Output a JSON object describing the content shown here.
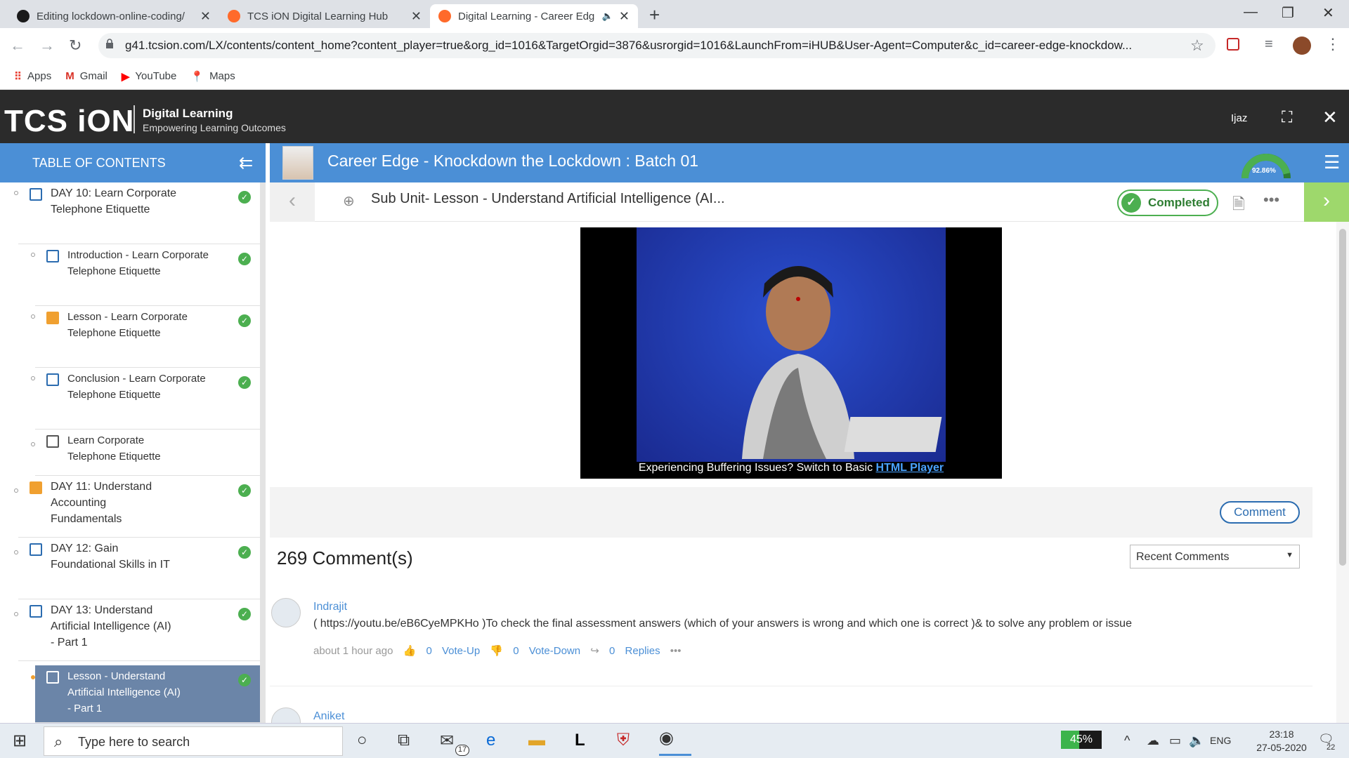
{
  "browser": {
    "tabs": [
      {
        "title": "Editing lockdown-online-coding/",
        "favicon_color": "#1a1a1a"
      },
      {
        "title": "TCS iON Digital Learning Hub",
        "favicon_color": "#ff6a2a"
      },
      {
        "title": "Digital Learning - Career Edg",
        "favicon_color": "#ff6a2a",
        "active": true
      }
    ],
    "url": "g41.tcsion.com/LX/contents/content_home?content_player=true&org_id=1016&TargetOrgid=3876&usrorgid=1016&LaunchFrom=iHUB&User-Agent=Computer&c_id=career-edge-knockdow...",
    "bookmarks": [
      "Apps",
      "Gmail",
      "YouTube",
      "Maps"
    ]
  },
  "header": {
    "logo": "TCS iON",
    "logo_line1": "Digital Learning",
    "logo_line2": "Empowering Learning Outcomes",
    "user": "Ijaz"
  },
  "toc": {
    "title": "TABLE OF CONTENTS",
    "items": [
      {
        "label": "DAY 10: Learn Corporate Telephone Etiquette",
        "done": true
      },
      {
        "label": "Introduction - Learn Corporate Telephone Etiquette",
        "done": true
      },
      {
        "label": "Lesson - Learn Corporate Telephone Etiquette",
        "done": true
      },
      {
        "label": "Conclusion - Learn Corporate Telephone Etiquette",
        "done": true
      },
      {
        "label": "Learn Corporate Telephone Etiquette",
        "done": false
      },
      {
        "label": "DAY 11: Understand Accounting Fundamentals",
        "done": true
      },
      {
        "label": "DAY 12: Gain Foundational Skills in IT",
        "done": true
      },
      {
        "label": "DAY 13: Understand Artificial Intelligence (AI) - Part 1",
        "done": true
      },
      {
        "label": "Lesson - Understand Artificial Intelligence (AI) - Part 1",
        "done": true,
        "active": true
      }
    ]
  },
  "course": {
    "title": "Career Edge - Knockdown the Lockdown : Batch 01",
    "progress": "92.86%",
    "progress_value": 0.9286
  },
  "lesson": {
    "title": "Sub Unit- Lesson - Understand Artificial Intelligence (AI...",
    "status": "Completed"
  },
  "video": {
    "buffer_text": "Experiencing Buffering Issues? Switch to Basic ",
    "buffer_link": "HTML Player"
  },
  "comments": {
    "button": "Comment",
    "count_label": "269 Comment(s)",
    "sort": "Recent Comments",
    "list": [
      {
        "author": "Indrajit",
        "text": "( https://youtu.be/eB6CyeMPKHo )To check the final assessment answers (which of your answers is wrong and which one is correct )& to solve any problem or issue",
        "time": "about 1 hour ago",
        "upvotes": "0",
        "upvote_label": "Vote-Up",
        "downvotes": "0",
        "downvote_label": "Vote-Down",
        "replies": "0",
        "replies_label": "Replies"
      },
      {
        "author": "Aniket"
      }
    ]
  },
  "taskbar": {
    "search_placeholder": "Type here to search",
    "mail_badge": "17",
    "battery": "45%",
    "battery_value": 0.45,
    "lang": "ENG",
    "time": "23:18",
    "date": "27-05-2020",
    "notifications": "22"
  }
}
